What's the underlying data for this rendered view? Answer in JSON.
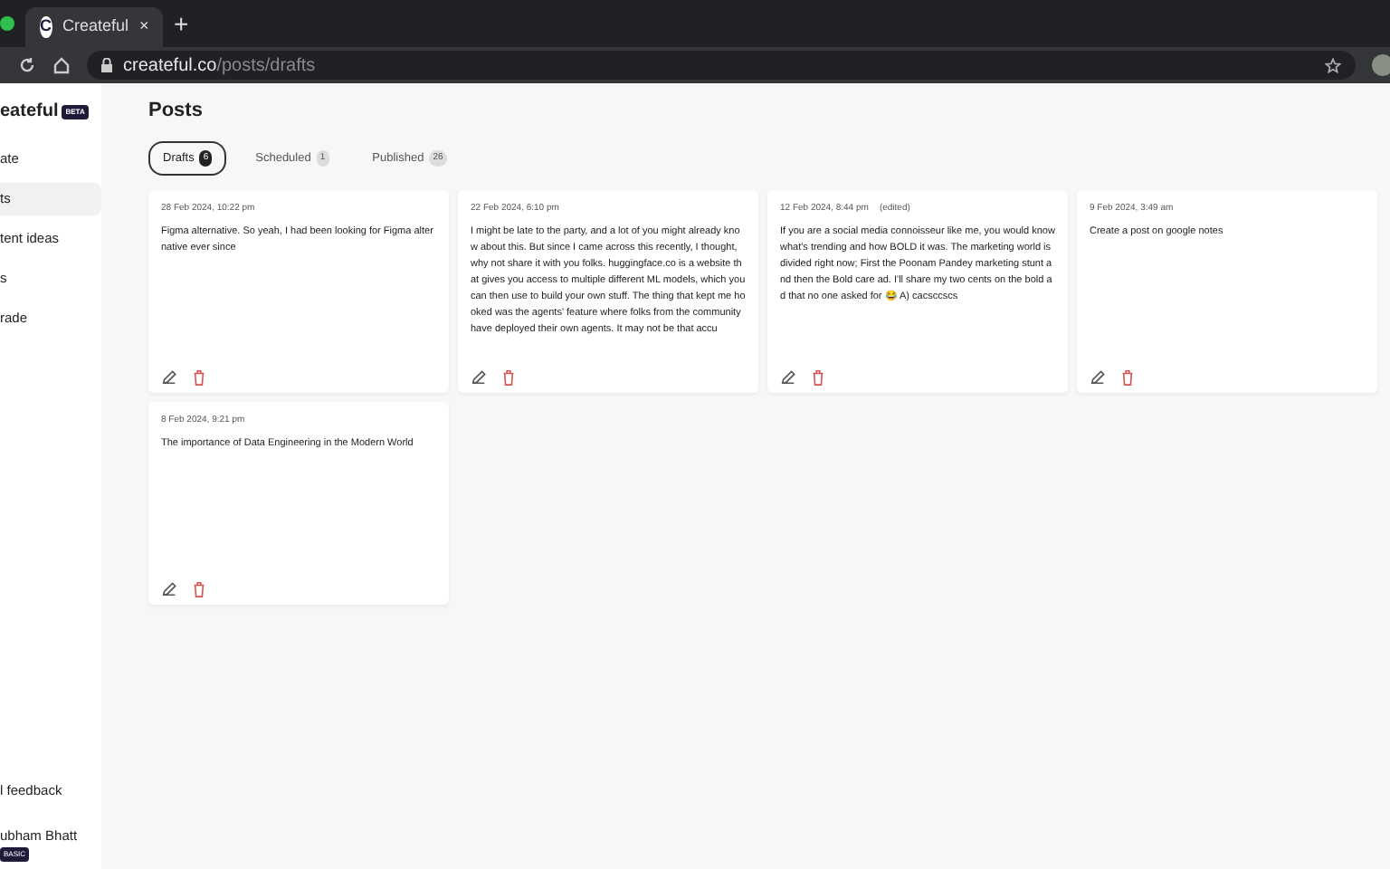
{
  "browser": {
    "tab_title": "Createful",
    "tab_icon": "C",
    "new_tab": "+",
    "close": "×",
    "url_host": "createful.co",
    "url_path": "/posts/drafts"
  },
  "sidebar": {
    "brand": "eateful",
    "brand_badge": "BETA",
    "items": [
      {
        "label": "ate",
        "selected": false
      },
      {
        "label": "ts",
        "selected": true
      },
      {
        "label": "tent ideas",
        "selected": false
      },
      {
        "label": "s",
        "selected": false
      },
      {
        "label": "rade",
        "selected": false
      }
    ],
    "feedback": "l feedback",
    "user_name": "ubham Bhatt",
    "user_badge": "BASIC"
  },
  "page_title": "Posts",
  "tabs": [
    {
      "label": "Drafts",
      "count": "6",
      "selected": true
    },
    {
      "label": "Scheduled",
      "count": "1",
      "selected": false
    },
    {
      "label": "Published",
      "count": "26",
      "selected": false
    }
  ],
  "posts": [
    {
      "date": "28 Feb 2024, 10:22 pm",
      "text": "Figma alternative. So yeah, I had been looking for Figma alternative ever since"
    },
    {
      "date": "22 Feb 2024, 6:10 pm",
      "text": "I might be late to the party, and a lot of you might already know about this. But since I came across this recently, I thought, why not share it with you folks. huggingface.co is a website that gives you access to multiple different ML models, which you can then use to build your own stuff. The thing that kept me hooked was the agents' feature where folks from the community have deployed their own agents. It may not be that accu"
    },
    {
      "date": "12 Feb 2024, 8:44 pm",
      "edited": "(edited)",
      "text": "If you are a social media connoisseur like me, you would know what's trending and how BOLD it was. The marketing world is divided right now; First the Poonam Pandey marketing stunt and then the Bold care ad. I'll share my two cents on the bold ad that no one asked for 😂 A) cacsccscs"
    },
    {
      "date": "9 Feb 2024, 3:49 am",
      "text": "Create a post on google notes"
    },
    {
      "date": "8 Feb 2024, 9:21 pm",
      "text": "The importance of Data Engineering in the Modern World"
    }
  ]
}
